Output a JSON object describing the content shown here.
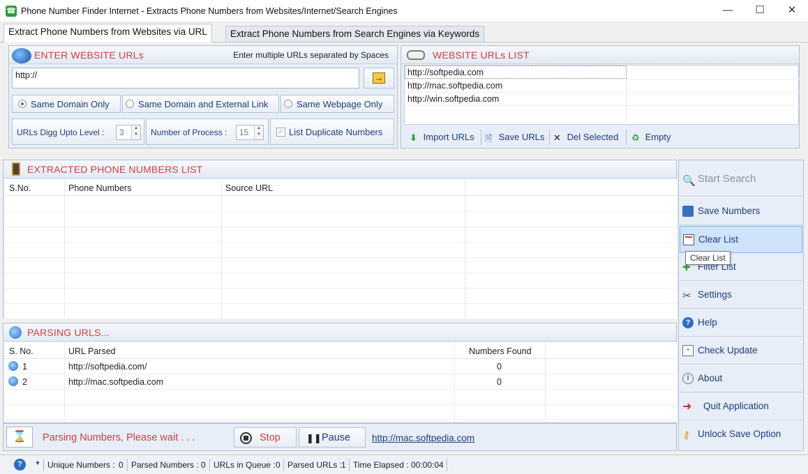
{
  "window": {
    "title": "Phone Number Finder Internet - Extracts Phone Numbers from Websites/Internet/Search Engines",
    "minimize": "—",
    "maximize": "☐",
    "close": "✕"
  },
  "tabs": [
    {
      "label": "Extract Phone Numbers from Websites via URL",
      "active": true
    },
    {
      "label": "Extract Phone Numbers from Search Engines via Keywords",
      "active": false
    }
  ],
  "enter_urls": {
    "title": "ENTER WEBSITE URLs",
    "hint": "Enter multiple URLs separated by Spaces",
    "url_value": "http://",
    "go_icon": "arrow-right-icon"
  },
  "crawl_options": [
    {
      "label": "Same Domain Only",
      "selected": true
    },
    {
      "label": "Same Domain and External Link",
      "selected": false
    },
    {
      "label": "Same Webpage Only",
      "selected": false
    }
  ],
  "settings_row": {
    "digg_label": "URLs Digg Upto Level :",
    "digg_value": "3",
    "process_label": "Number of Process :",
    "process_value": "15",
    "duplicate_label": "List Duplicate Numbers",
    "duplicate_checked": true
  },
  "url_list": {
    "title": "WEBSITE URLs LIST",
    "items": [
      "http://softpedia.com",
      "http://mac.softpedia.com",
      "http://win.softpedia.com"
    ],
    "buttons": {
      "import": "Import URLs",
      "save": "Save URLs",
      "del": "Del Selected",
      "empty": "Empty"
    }
  },
  "extracted": {
    "title": "EXTRACTED PHONE NUMBERS LIST",
    "columns": [
      "S.No.",
      "Phone Numbers",
      "Source URL"
    ]
  },
  "parsing": {
    "title": "PARSING URLS...",
    "columns": [
      "S. No.",
      "URL Parsed",
      "Numbers Found"
    ],
    "rows": [
      {
        "sno": "1",
        "url": "http://softpedia.com/",
        "found": "0"
      },
      {
        "sno": "2",
        "url": "http://mac.softpedia.com",
        "found": "0"
      }
    ]
  },
  "progress": {
    "message": "Parsing Numbers, Please wait . . .",
    "stop": "Stop",
    "pause": "Pause",
    "current_url": "http://mac.softpedia.com"
  },
  "side_buttons": {
    "start": "Start Search",
    "save": "Save Numbers",
    "clear": "Clear List",
    "filter": "Filter List",
    "settings": "Settings",
    "help": "Help",
    "update": "Check Update",
    "about": "About",
    "quit": "Quit Application",
    "unlock": "Unlock Save Option"
  },
  "tooltip": "Clear List",
  "status": {
    "unique_label": "Unique Numbers :",
    "unique_value": "0",
    "parsed_label": "Parsed Numbers :",
    "parsed_value": "0",
    "queue_label": "URLs in Queue :",
    "queue_value": "0",
    "parsed_urls_label": "Parsed URLs :",
    "parsed_urls_value": "1",
    "elapsed_label": "Time Elapsed :",
    "elapsed_value": "00:00:04"
  },
  "colors": {
    "accent_red": "#d04040",
    "link_blue": "#1f3d7a",
    "panel_bg": "#e7eef8",
    "border": "#b2c1d4"
  }
}
